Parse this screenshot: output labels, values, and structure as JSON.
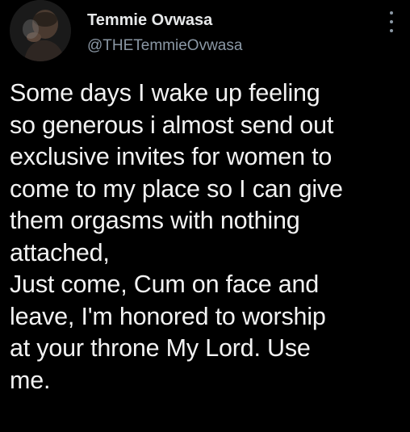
{
  "author": {
    "display_name": "Temmie Ovwasa",
    "handle": "@THETemmieOvwasa"
  },
  "tweet": {
    "lines": [
      "Some days I wake up feeling",
      "so generous i almost send out",
      "exclusive invites for women to",
      "come to my place so I can give",
      "them orgasms with nothing",
      "attached,",
      "Just come, Cum on face and",
      "leave, I'm honored to worship",
      "at your throne My Lord. Use",
      "me."
    ]
  },
  "icons": {
    "more": "more-vertical-icon",
    "avatar": "profile-photo"
  },
  "colors": {
    "background": "#000000",
    "primary_text": "#e7e9ea",
    "secondary_text": "#8b98a5"
  }
}
